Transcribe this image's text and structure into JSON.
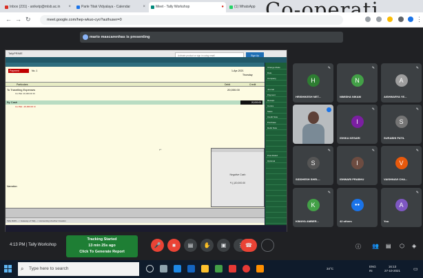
{
  "browser": {
    "tabs": [
      {
        "label": "Inbox (231) - aniketp@mlsb.ac.in",
        "color": "#d93025"
      },
      {
        "label": "Parle Tilak Vidyalaya - Calendar",
        "color": "#1a73e8"
      },
      {
        "label": "Meet - Tally Workshop",
        "color": "#00897b"
      },
      {
        "label": "(1) WhatsApp",
        "color": "#25d366"
      }
    ],
    "overlay_text": "Co-operati",
    "url": "meet.google.com/hep-wkuo-cyo?authuser=0"
  },
  "meet": {
    "presenter_notice": "mario mascarenhas is presenting",
    "participants": [
      {
        "name": "HRISHIKESH NET...",
        "initial": "H",
        "color": "#2e7d32"
      },
      {
        "name": "NIMISHA NIKAM",
        "initial": "N",
        "color": "#43a047"
      },
      {
        "name": "AISHWARYA YE...",
        "initial": "A",
        "color": "#9e9e9e"
      },
      {
        "name": "",
        "initial": "",
        "color": "#8d9aa0"
      },
      {
        "name": "ISHIKA KESARI",
        "initial": "I",
        "color": "#7b1fa2"
      },
      {
        "name": "SURABHI PATIL",
        "initial": "S",
        "color": "#757575"
      },
      {
        "name": "SIDDHESH SHEL...",
        "initial": "S",
        "color": "#555555"
      },
      {
        "name": "ISHWARI PRABHU",
        "initial": "I",
        "color": "#6d4c41"
      },
      {
        "name": "VAISHNAVI CHA...",
        "initial": "V",
        "color": "#e8590c"
      },
      {
        "name": "KIMAYA AMBER...",
        "initial": "K",
        "color": "#43a047"
      },
      {
        "name": "42 others",
        "initial": "",
        "color": "#1a73e8"
      },
      {
        "name": "You",
        "initial": "A",
        "color": "#7e57c2"
      }
    ],
    "time_label": "4:13 PM | Tally Workshop",
    "tracking": {
      "line1": "Tracking Started",
      "line2": "13 min 25s ago",
      "line3": "Click To Generate Report"
    }
  },
  "tally": {
    "title": "TallyPRIME",
    "menu": [
      "K: Pick",
      "Y: Export",
      "M: E-Mail",
      "O: Upload",
      "S: TallyShop",
      "G: Go To",
      "C: Company",
      "H: Help"
    ],
    "sign_in_placeholder": "Activate product or sign in using email",
    "sign_in_button": "Sign Up",
    "voucher_type": "Payment",
    "voucher_no": "No. 1",
    "date": "1-Apr-2021",
    "day": "Thursday",
    "particulars_header": "Particulars",
    "debit_header": "Debit",
    "credit_header": "Credit",
    "line1": "To  Travelling Expenses",
    "line1_amt": "20,000.00",
    "line1_sub": "Cur Bal: 20,000.00 Dr",
    "line2": "By  Cash",
    "line2_amt": "20,000.00",
    "line2_sub": "Cur Bal: -20,000.00 Cr",
    "narration": "Narration:",
    "popup_line1": "Negative Cash",
    "popup_line2": "₹ (-)20,000.00",
    "side_items": [
      "Change Mode",
      "Date",
      "Company",
      "",
      "Journal",
      "Payment",
      "Receipt",
      "Contra",
      "Sales",
      "Credit Note",
      "Purchase",
      "Debit Note",
      "",
      "",
      "",
      "",
      "Post-Dated",
      "Optional",
      "",
      "",
      "",
      "",
      "",
      "",
      "",
      "",
      "",
      "",
      "",
      "Configure"
    ],
    "status": "Tally MAIN --> Gateway of Tally --> Accounting Voucher Creation",
    "inner_search": "Type here to search"
  },
  "taskbar": {
    "search_placeholder": "Type here to search",
    "temperature": "34°C",
    "language": "ENG",
    "region": "IN",
    "time": "16:13",
    "date": "27-10-2021"
  }
}
